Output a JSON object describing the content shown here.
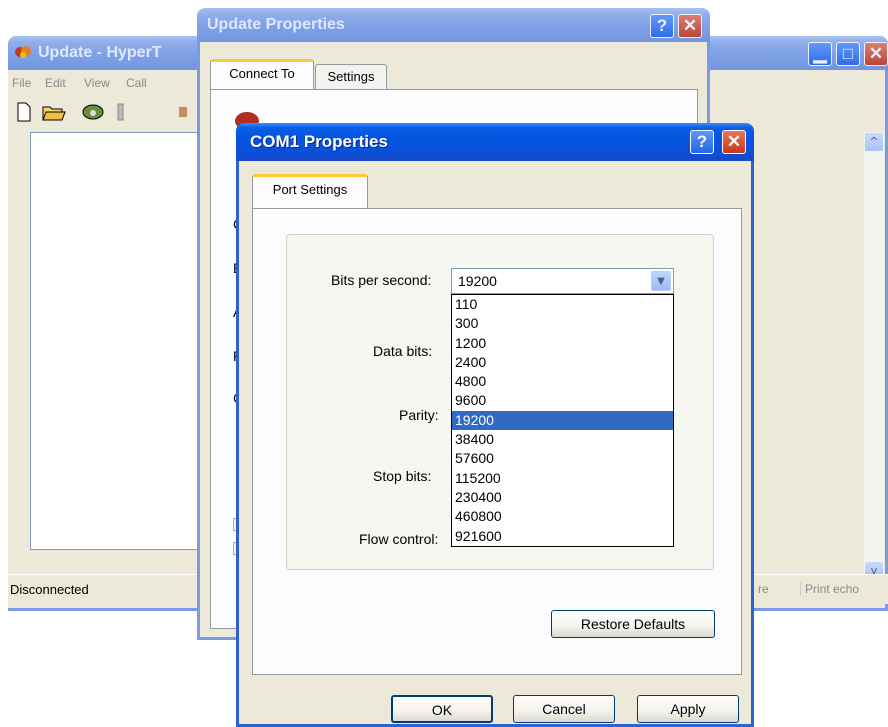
{
  "hyper": {
    "title": "Update - HyperT",
    "menu": [
      "File",
      "Edit",
      "View",
      "Call"
    ],
    "status_left": "Disconnected",
    "status_right_1": "re",
    "status_right_2": "Print echo"
  },
  "update_props": {
    "title": "Update Properties",
    "tabs": [
      "Connect To",
      "Settings"
    ],
    "side_letters": [
      "C",
      "E",
      "A",
      "F",
      "C"
    ]
  },
  "com1": {
    "title": "COM1 Properties",
    "tab": "Port Settings",
    "labels": {
      "bits_per_second": "Bits per second:",
      "data_bits": "Data bits:",
      "parity": "Parity:",
      "stop_bits": "Stop bits:",
      "flow_control": "Flow control:"
    },
    "bits_per_second_value": "19200",
    "baud_options": [
      "110",
      "300",
      "1200",
      "2400",
      "4800",
      "9600",
      "19200",
      "38400",
      "57600",
      "115200",
      "230400",
      "460800",
      "921600"
    ],
    "selected_option": "19200",
    "restore_defaults": "Restore Defaults",
    "ok": "OK",
    "cancel": "Cancel",
    "apply": "Apply"
  },
  "colors": {
    "xp_blue": "#0554e0",
    "selection": "#316ac5",
    "dialog_bg": "#ece9d8",
    "tab_accent": "#ffc83c"
  }
}
